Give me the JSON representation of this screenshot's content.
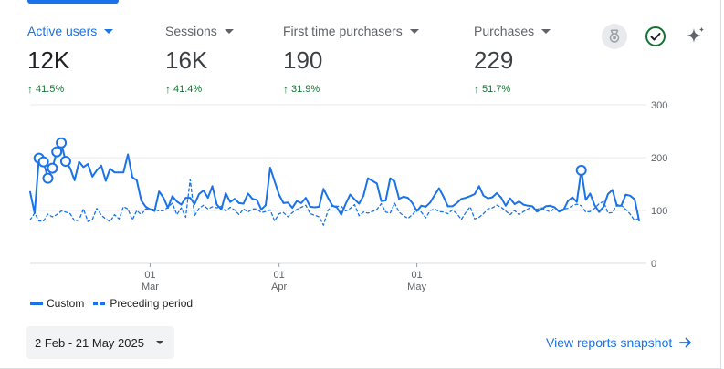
{
  "metrics": [
    {
      "label": "Active users",
      "value": "12K",
      "change": "41.5%",
      "active": true
    },
    {
      "label": "Sessions",
      "value": "16K",
      "change": "41.4%",
      "active": false
    },
    {
      "label": "First time purchasers",
      "value": "190",
      "change": "31.9%",
      "active": false
    },
    {
      "label": "Purchases",
      "value": "229",
      "change": "51.7%",
      "active": false
    }
  ],
  "icons": {
    "badge": "award-badge-icon",
    "check": "check-circle-icon",
    "sparkle": "sparkle-icon"
  },
  "colors": {
    "accent": "#1a73e8",
    "positive": "#137333",
    "grid": "#e8eaed"
  },
  "chart_data": {
    "type": "line",
    "ylim": [
      0,
      300
    ],
    "yticks": [
      "300",
      "200",
      "100",
      "0"
    ],
    "xticks": [
      {
        "day": "01",
        "month": "Mar"
      },
      {
        "day": "01",
        "month": "Apr"
      },
      {
        "day": "01",
        "month": "May"
      }
    ],
    "series": [
      {
        "name": "Custom",
        "style": "solid",
        "values": [
          135,
          95,
          199,
          192,
          161,
          180,
          211,
          228,
          193,
          180,
          157,
          192,
          182,
          188,
          164,
          176,
          185,
          156,
          179,
          172,
          172,
          172,
          206,
          163,
          157,
          119,
          107,
          102,
          99,
          136,
          124,
          105,
          127,
          117,
          111,
          124,
          124,
          112,
          131,
          138,
          124,
          146,
          111,
          102,
          133,
          116,
          122,
          114,
          113,
          132,
          122,
          120,
          102,
          110,
          181,
          155,
          130,
          114,
          115,
          105,
          118,
          114,
          124,
          107,
          106,
          107,
          141,
          124,
          109,
          106,
          92,
          113,
          130,
          121,
          113,
          128,
          161,
          156,
          151,
          118,
          119,
          161,
          155,
          122,
          126,
          124,
          114,
          99,
          109,
          107,
          115,
          129,
          142,
          126,
          108,
          108,
          114,
          122,
          124,
          127,
          131,
          146,
          128,
          123,
          125,
          133,
          124,
          109,
          123,
          112,
          117,
          111,
          109,
          108,
          98,
          102,
          108,
          109,
          106,
          98,
          101,
          118,
          125,
          116,
          176,
          120,
          132,
          110,
          97,
          107,
          131,
          139,
          109,
          109,
          130,
          128,
          121,
          81
        ]
      },
      {
        "name": "Preceding period",
        "style": "dashed",
        "values": [
          82,
          95,
          80,
          80,
          93,
          88,
          92,
          99,
          97,
          94,
          80,
          82,
          103,
          79,
          83,
          104,
          91,
          84,
          79,
          92,
          84,
          107,
          103,
          82,
          100,
          92,
          103,
          103,
          102,
          99,
          100,
          106,
          114,
          92,
          105,
          87,
          159,
          90,
          104,
          110,
          103,
          107,
          105,
          108,
          99,
          106,
          101,
          92,
          103,
          97,
          103,
          103,
          96,
          98,
          101,
          80,
          94,
          96,
          88,
          96,
          102,
          106,
          110,
          94,
          91,
          88,
          72,
          100,
          110,
          108,
          108,
          99,
          104,
          111,
          90,
          97,
          95,
          98,
          102,
          113,
          97,
          95,
          114,
          97,
          90,
          85,
          92,
          102,
          97,
          86,
          100,
          103,
          98,
          97,
          94,
          101,
          94,
          83,
          96,
          107,
          84,
          87,
          94,
          103,
          105,
          110,
          106,
          99,
          92,
          100,
          92,
          98,
          103,
          108,
          102,
          105,
          101,
          97,
          105,
          100,
          103,
          104,
          109,
          112,
          109,
          97,
          98,
          104,
          113,
          117,
          95,
          96,
          111,
          110,
          102,
          93,
          81,
          86
        ]
      }
    ]
  },
  "legend": {
    "custom": "Custom",
    "preceding": "Preceding period"
  },
  "date_range": "2 Feb - 21 May 2025",
  "snapshot_link": "View reports snapshot"
}
